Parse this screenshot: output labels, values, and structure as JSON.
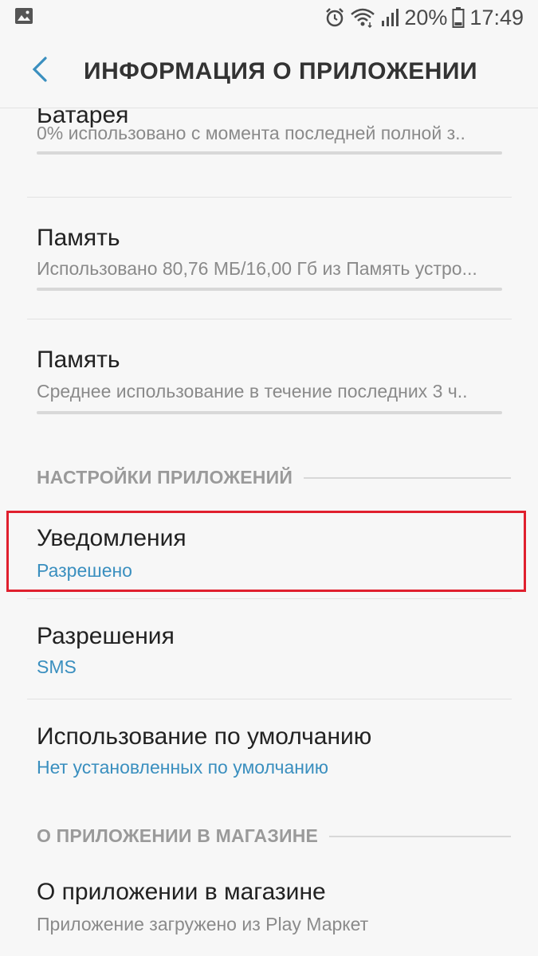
{
  "status_bar": {
    "battery_percent": "20%",
    "time": "17:49",
    "icons": [
      "image-icon",
      "alarm-icon",
      "wifi-icon",
      "signal-icon",
      "battery-icon"
    ]
  },
  "header": {
    "title": "ИНФОРМАЦИЯ О ПРИЛОЖЕНИИ",
    "back_icon": "chevron-left-icon"
  },
  "items_top": [
    {
      "title": "Батарея",
      "subtitle": "0% использовано с момента последней полной з..",
      "usage_bar": true
    },
    {
      "title": "Память",
      "subtitle": "Использовано 80,76 МБ/16,00 Гб из Память устро...",
      "usage_bar": true
    },
    {
      "title": "Память",
      "subtitle": "Среднее использование в течение последних 3 ч..",
      "usage_bar": true
    }
  ],
  "section_app_settings": {
    "label": "НАСТРОЙКИ ПРИЛОЖЕНИЙ",
    "items": [
      {
        "title": "Уведомления",
        "subtitle": "Разрешено"
      },
      {
        "title": "Разрешения",
        "subtitle": "SMS"
      },
      {
        "title": "Использование по умолчанию",
        "subtitle": "Нет установленных по умолчанию"
      }
    ]
  },
  "section_store": {
    "label": "О ПРИЛОЖЕНИИ В МАГАЗИНЕ",
    "items": [
      {
        "title": "О приложении в магазине",
        "subtitle": "Приложение загружено из Play Маркет"
      }
    ]
  },
  "colors": {
    "accent": "#3a8fbf",
    "highlight": "#e0202e",
    "background": "#f7f7f7"
  }
}
